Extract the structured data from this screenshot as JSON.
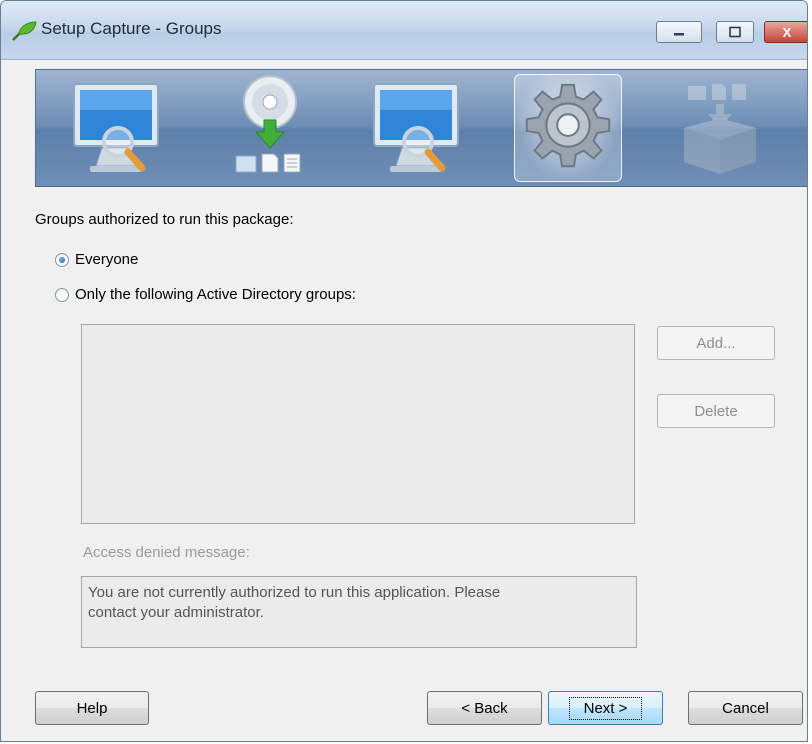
{
  "window": {
    "title": "Setup Capture - Groups"
  },
  "caption_buttons": {
    "minimize": "—",
    "maximize": "▢",
    "close": "X"
  },
  "wizard_steps": [
    {
      "icon": "monitor-magnifier-icon"
    },
    {
      "icon": "disc-download-icon"
    },
    {
      "icon": "monitor-magnifier-icon"
    },
    {
      "icon": "gear-icon",
      "active": true
    },
    {
      "icon": "package-box-icon"
    }
  ],
  "groups": {
    "heading": "Groups authorized to run this package:",
    "options": [
      {
        "label": "Everyone",
        "checked": true
      },
      {
        "label": "Only the following Active Directory groups:",
        "checked": false
      }
    ],
    "list_items": [],
    "add_label": "Add...",
    "delete_label": "Delete"
  },
  "access_denied": {
    "label": "Access denied message:",
    "line1": "You are not currently authorized to run this application. Please",
    "line2": "contact your administrator."
  },
  "footer": {
    "help": "Help",
    "back": "< Back",
    "next": "Next >",
    "cancel": "Cancel"
  }
}
